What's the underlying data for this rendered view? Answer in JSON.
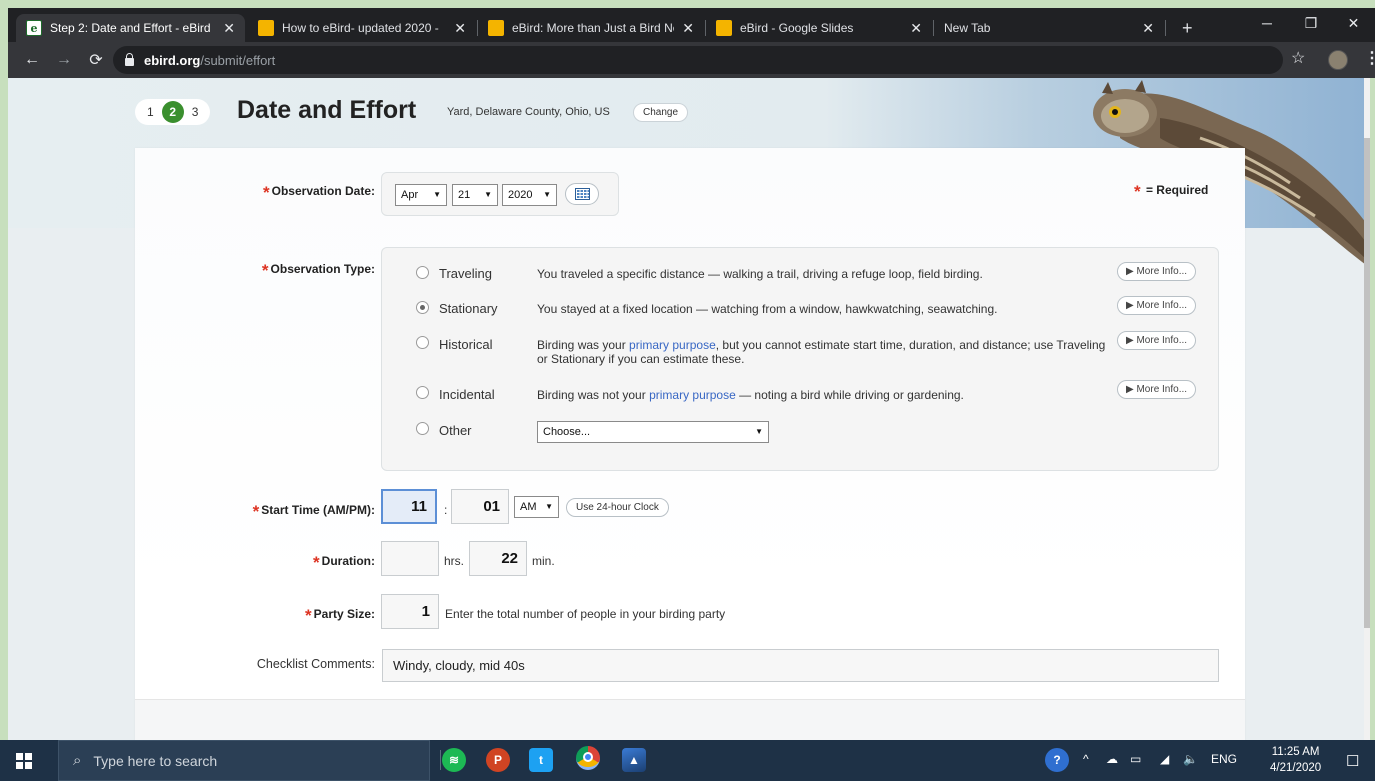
{
  "browser": {
    "tabs": [
      {
        "title": "Step 2: Date and Effort - eBird",
        "favicon": "ebird-icon",
        "active": true
      },
      {
        "title": "How to eBird- updated 2020 -",
        "favicon": "slides-icon",
        "active": false
      },
      {
        "title": "eBird: More than Just a Bird Ne",
        "favicon": "slides-icon",
        "active": false
      },
      {
        "title": "eBird - Google Slides",
        "favicon": "slides-icon",
        "active": false
      },
      {
        "title": "New Tab",
        "favicon": "",
        "active": false
      }
    ],
    "new_tab": "+",
    "url_host": "ebird.org",
    "url_path": "/submit/effort"
  },
  "header": {
    "steps": [
      "1",
      "2",
      "3"
    ],
    "current_step": "2",
    "title": "Date and Effort",
    "location": "Yard, Delaware County, Ohio, US",
    "change_label": "Change"
  },
  "form": {
    "required_note": "= Required",
    "date": {
      "label": "Observation Date:",
      "month": "Apr",
      "day": "21",
      "year": "2020"
    },
    "type": {
      "label": "Observation Type:",
      "more_info_label": "▶ More Info...",
      "options": [
        {
          "name": "Traveling",
          "desc": "You traveled a specific distance — walking a trail, driving a refuge loop, field birding.",
          "selected": false
        },
        {
          "name": "Stationary",
          "desc": "You stayed at a fixed location — watching from a window, hawkwatching, seawatching.",
          "selected": true
        },
        {
          "name": "Historical",
          "desc_pre": "Birding was your ",
          "desc_link": "primary purpose",
          "desc_post": ", but you cannot estimate start time, duration, and distance; use Traveling or Stationary if you can estimate these.",
          "selected": false
        },
        {
          "name": "Incidental",
          "desc_pre": "Birding was not your ",
          "desc_link": "primary purpose",
          "desc_post": " — noting a bird while driving or gardening.",
          "selected": false
        },
        {
          "name": "Other",
          "select_value": "Choose...",
          "selected": false
        }
      ]
    },
    "start_time": {
      "label": "Start Time (AM/PM):",
      "hour": "11",
      "separator": ":",
      "minute": "01",
      "ampm": "AM",
      "clock_toggle": "Use 24-hour Clock"
    },
    "duration": {
      "label": "Duration:",
      "hours": "",
      "hours_unit": "hrs.",
      "minutes": "22",
      "minutes_unit": "min."
    },
    "party": {
      "label": "Party Size:",
      "value": "1",
      "hint": "Enter the total number of people in your birding party"
    },
    "comments": {
      "label": "Checklist Comments:",
      "value": "Windy, cloudy, mid 40s"
    }
  },
  "taskbar": {
    "search_placeholder": "Type here to search",
    "lang": "ENG",
    "time": "11:25 AM",
    "date": "4/21/2020"
  },
  "colors": {
    "accent_green": "#3a8f2e",
    "required_red": "#dd3322",
    "link_blue": "#3867c4"
  }
}
